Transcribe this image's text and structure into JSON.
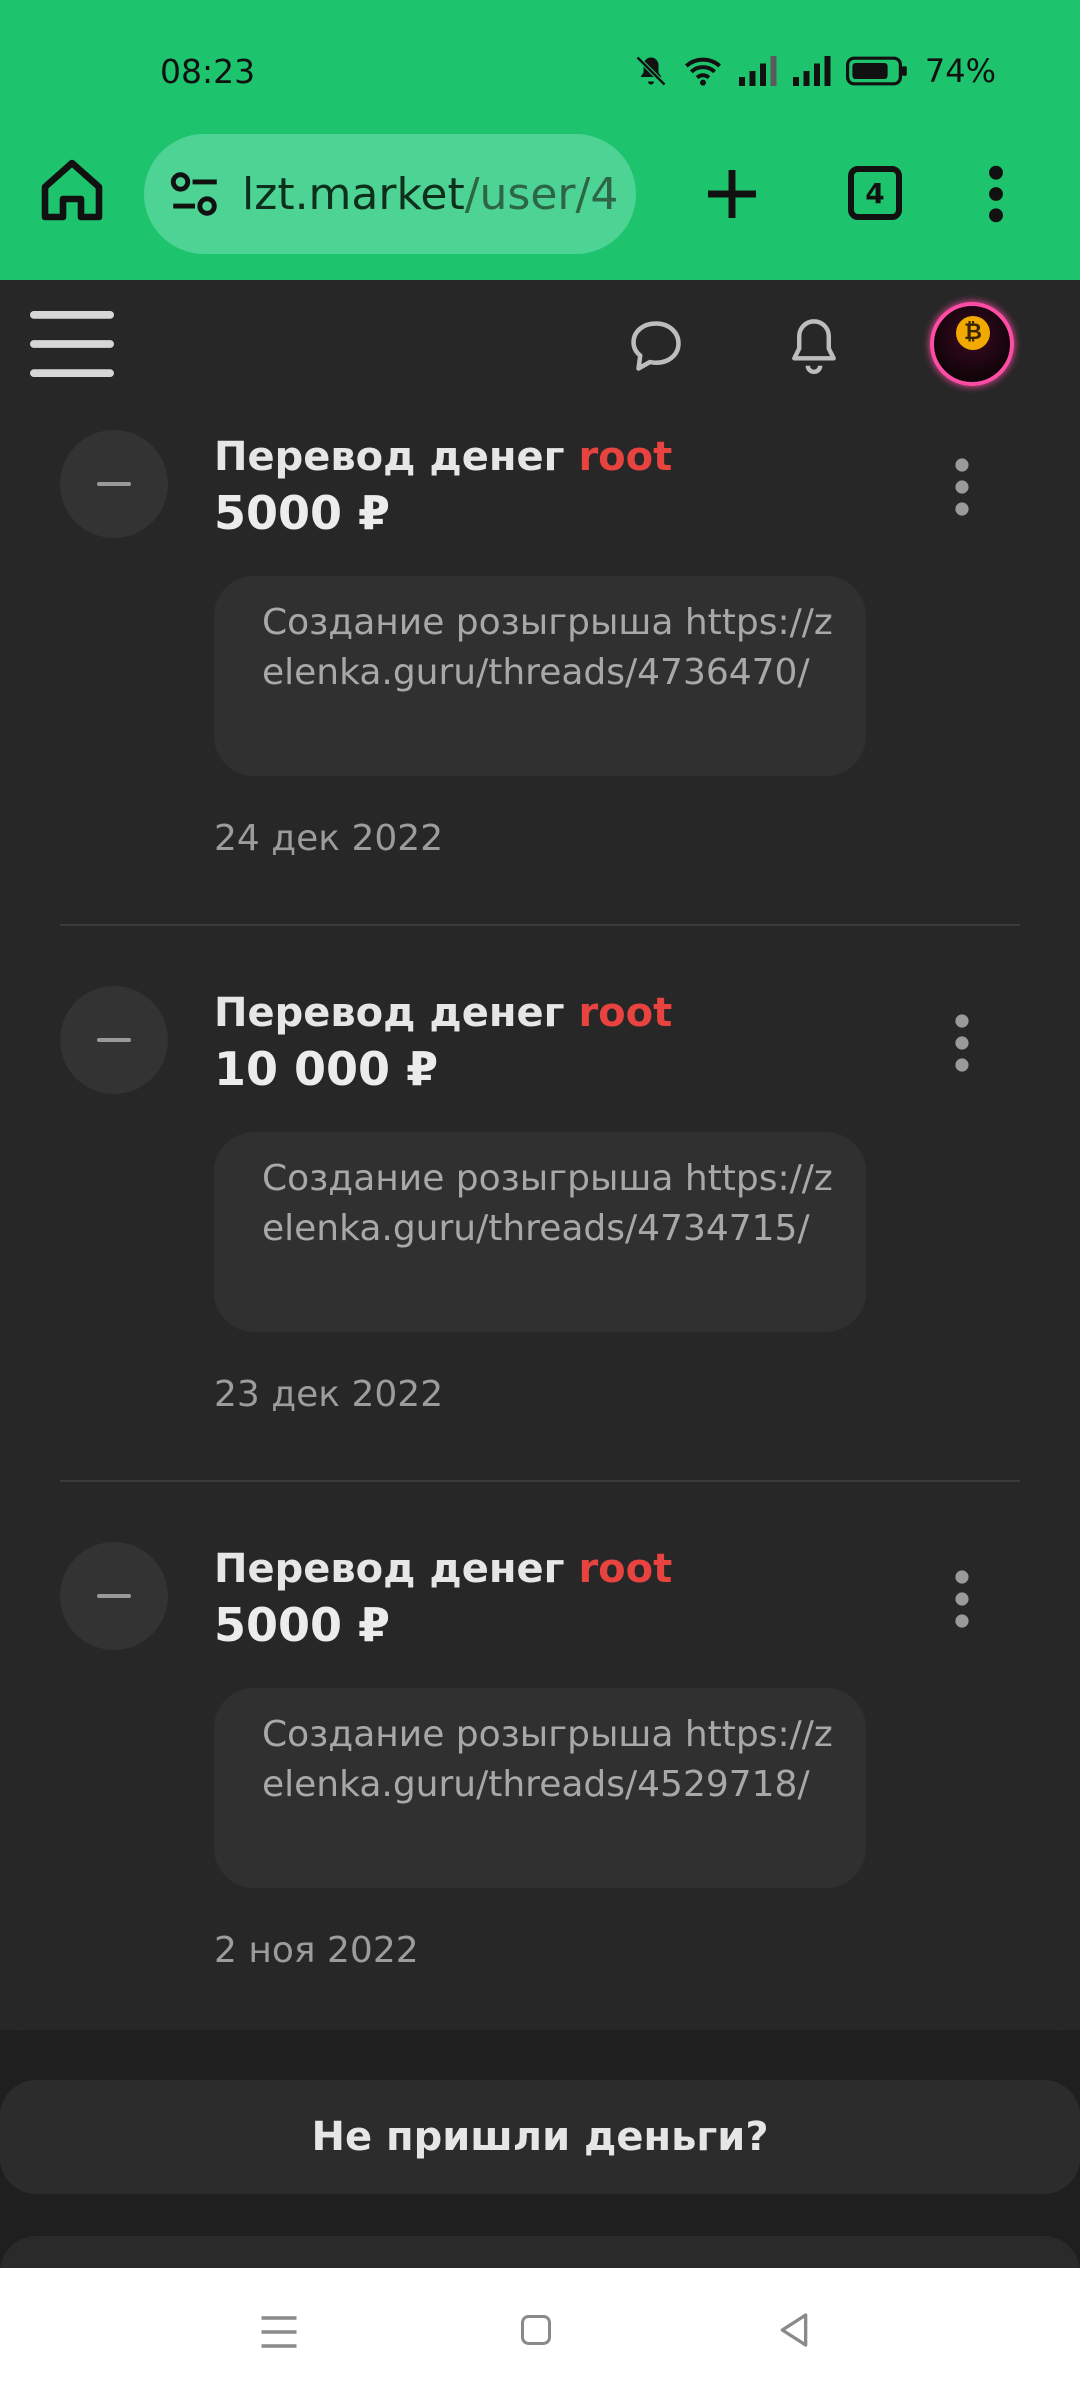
{
  "status_bar": {
    "time": "08:23",
    "battery_percent": "74%"
  },
  "browser": {
    "url_host": "lzt.market",
    "url_path": "/user/4",
    "tab_count": "4"
  },
  "transactions": [
    {
      "title": "Перевод денег",
      "user": "root",
      "amount": "5000 ₽",
      "comment": "Создание розыгрыша https://zelenka.guru/threads/4736470/",
      "date": "24 дек 2022"
    },
    {
      "title": "Перевод денег",
      "user": "root",
      "amount": "10 000 ₽",
      "comment": "Создание розыгрыша https://zelenka.guru/threads/4734715/",
      "date": "23 дек 2022"
    },
    {
      "title": "Перевод денег",
      "user": "root",
      "amount": "5000 ₽",
      "comment": "Создание розыгрыша https://zelenka.guru/threads/4529718/",
      "date": "2 ноя 2022"
    }
  ],
  "help_button_label": "Не пришли деньги?",
  "colors": {
    "accent_green": "#1ec46d",
    "username_red": "#e8433f",
    "background": "#272727"
  },
  "icons": {
    "home": "home-icon",
    "site_settings": "tune-icon",
    "new_tab": "plus-icon",
    "browser_menu": "more-vertical-icon",
    "menu": "hamburger-icon",
    "messages": "chat-bubble-icon",
    "notifications": "bell-icon",
    "transaction": "minus-icon"
  }
}
